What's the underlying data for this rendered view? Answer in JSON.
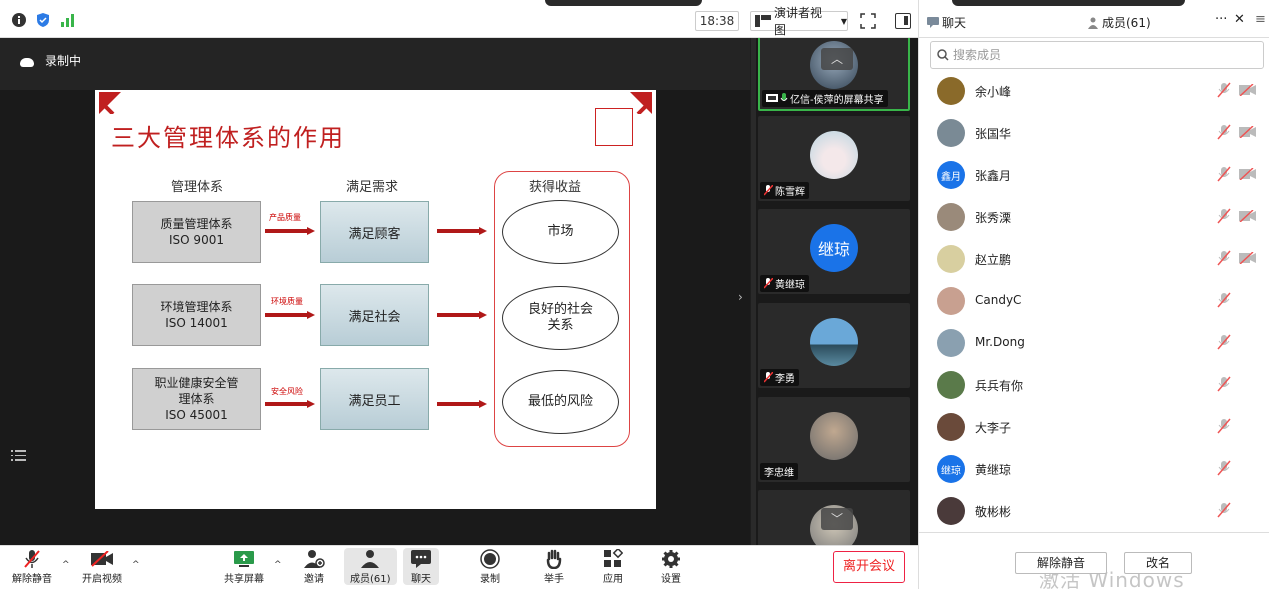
{
  "top": {
    "time": "18:38",
    "view_label": "演讲者视图"
  },
  "share": {
    "recording_label": "录制中",
    "slide": {
      "title": "三大管理体系的作用",
      "col_headers": [
        "管理体系",
        "满足需求",
        "获得收益"
      ],
      "rows": [
        {
          "system_line1": "质量管理体系",
          "system_line2": "",
          "system_code": "ISO 9001",
          "arrow_label": "产品质量",
          "need": "满足顾客",
          "gain": "市场"
        },
        {
          "system_line1": "环境管理体系",
          "system_line2": "",
          "system_code": "ISO 14001",
          "arrow_label": "环境质量",
          "need": "满足社会",
          "gain": "良好的社会\n关系"
        },
        {
          "system_line1": "职业健康安全管",
          "system_line2": "理体系",
          "system_code": "ISO 45001",
          "arrow_label": "安全风险",
          "need": "满足员工",
          "gain": "最低的风险"
        }
      ]
    }
  },
  "video_strip": {
    "tiles": [
      {
        "name": "亿信-侯萍的屏幕共享",
        "avatar": "landscape",
        "active": true
      },
      {
        "name": "陈雪辉",
        "avatar": "flower"
      },
      {
        "name": "黄继琼",
        "avatar_text": "继琼",
        "avatar_color": "#1a73e8"
      },
      {
        "name": "李勇",
        "avatar": "island"
      },
      {
        "name": "李忠维",
        "avatar": "person"
      },
      {
        "name": "",
        "avatar": "person2"
      }
    ]
  },
  "toolbar": {
    "unmute": "解除静音",
    "start_video": "开启视频",
    "share_screen": "共享屏幕",
    "invite": "邀请",
    "members": "成员(61)",
    "chat": "聊天",
    "record": "录制",
    "raise_hand": "举手",
    "apps": "应用",
    "settings": "设置",
    "leave": "离开会议"
  },
  "panel": {
    "chat_tab": "聊天",
    "members_tab": "成员(61)",
    "more": "···",
    "close": "✕",
    "search_placeholder": "搜索成员",
    "members": [
      {
        "name": "余小峰",
        "avatar_color": "#8a6a2a",
        "cam": true
      },
      {
        "name": "张国华",
        "avatar_color": "#7a8a95",
        "cam": true
      },
      {
        "name": "张鑫月",
        "avatar_text": "鑫月",
        "avatar_color": "#1a73e8",
        "cam": true
      },
      {
        "name": "张秀溧",
        "avatar_color": "#9a8a7a",
        "cam": true
      },
      {
        "name": "赵立鹏",
        "avatar_color": "#d8cfa0",
        "cam": true
      },
      {
        "name": "CandyC",
        "avatar_color": "#c8a090",
        "cam": false
      },
      {
        "name": "Mr.Dong",
        "avatar_color": "#8aa0b0",
        "cam": false
      },
      {
        "name": "兵兵有你",
        "avatar_color": "#5a7a4a",
        "cam": false
      },
      {
        "name": "大李子",
        "avatar_color": "#6a4a3a",
        "cam": false
      },
      {
        "name": "黄继琼",
        "avatar_text": "继琼",
        "avatar_color": "#1a73e8",
        "cam": false
      },
      {
        "name": "敬彬彬",
        "avatar_color": "#4a3a3a",
        "cam": false
      }
    ],
    "footer": {
      "unmute_all": "解除静音",
      "rename": "改名",
      "watermark": "激活 Windows"
    }
  },
  "colors": {
    "accent_red": "#c02020",
    "active_green": "#39b54a",
    "avatar_blue": "#1a73e8"
  }
}
